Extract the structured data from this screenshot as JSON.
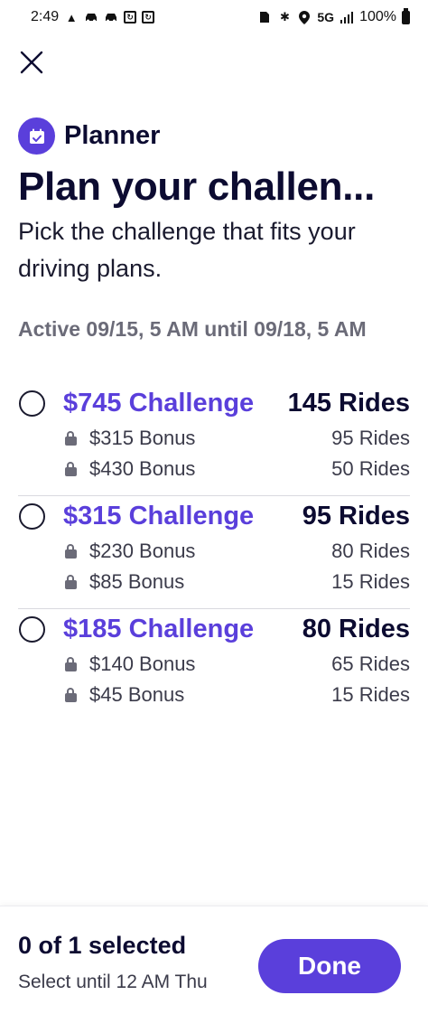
{
  "status_bar": {
    "time": "2:49",
    "network": "5G",
    "battery": "100%",
    "left_icons": [
      "navigation-icon",
      "car-icon",
      "car-icon",
      "app-icon",
      "app-icon"
    ],
    "right_icons": [
      "sim-icon",
      "bluetooth-icon",
      "location-icon",
      "signal-icon",
      "battery-icon"
    ]
  },
  "header": {
    "close_icon": "close-icon",
    "planner_icon": "calendar-icon",
    "planner_label": "Planner",
    "title": "Plan your challen...",
    "subtitle": "Pick the challenge that fits your driving plans."
  },
  "active_range": "Active 09/15, 5 AM until 09/18, 5 AM",
  "challenges": [
    {
      "name": "$745 Challenge",
      "rides": "145 Rides",
      "bonuses": [
        {
          "label": "$315 Bonus",
          "rides": "95 Rides"
        },
        {
          "label": "$430 Bonus",
          "rides": "50 Rides"
        }
      ]
    },
    {
      "name": "$315 Challenge",
      "rides": "95 Rides",
      "bonuses": [
        {
          "label": "$230 Bonus",
          "rides": "80 Rides"
        },
        {
          "label": "$85 Bonus",
          "rides": "15 Rides"
        }
      ]
    },
    {
      "name": "$185 Challenge",
      "rides": "80 Rides",
      "bonuses": [
        {
          "label": "$140 Bonus",
          "rides": "65 Rides"
        },
        {
          "label": "$45 Bonus",
          "rides": "15 Rides"
        }
      ]
    }
  ],
  "footer": {
    "selected_count": "0 of 1 selected",
    "select_until": "Select until 12 AM Thu",
    "done_label": "Done"
  },
  "colors": {
    "accent": "#5a3fdb",
    "text": "#0c0b31",
    "muted": "#6b6b78"
  }
}
